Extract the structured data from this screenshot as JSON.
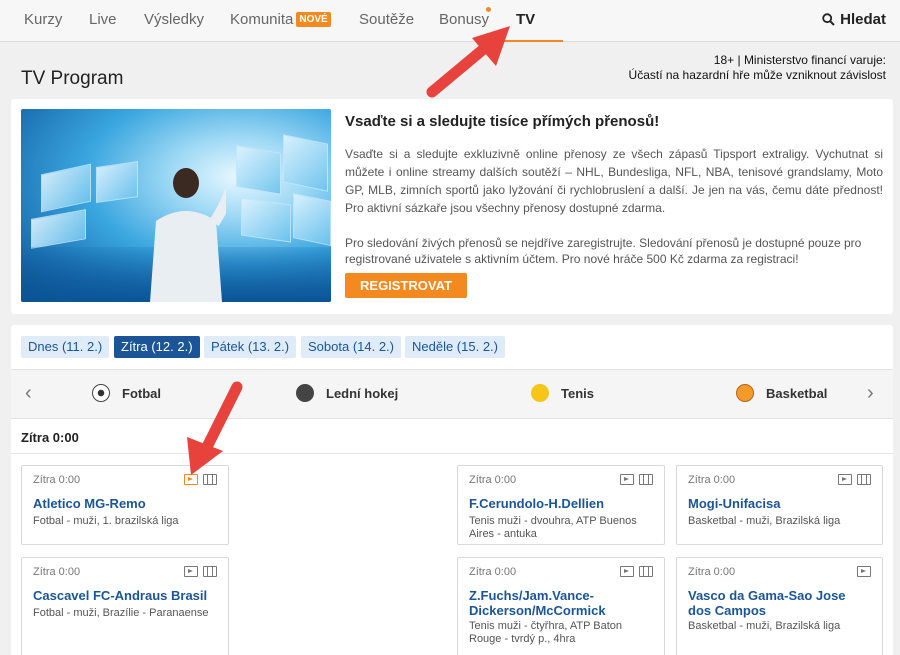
{
  "nav": {
    "items": [
      {
        "label": "Kurzy"
      },
      {
        "label": "Live"
      },
      {
        "label": "Výsledky"
      },
      {
        "label": "Komunita",
        "badge": "NOVÉ"
      },
      {
        "label": "Soutěže"
      },
      {
        "label": "Bonusy"
      },
      {
        "label": "TV",
        "active": true
      }
    ],
    "search_label": "Hledat"
  },
  "page_title": "TV Program",
  "warning": {
    "line1": "18+ | Ministerstvo financí varuje:",
    "line2": "Účastí na hazardní hře může vzniknout závislost"
  },
  "promo": {
    "title": "Vsaďte si a sledujte tisíce přímých přenosů!",
    "text": "Vsaďte si a sledujte exkluzivně online přenosy ze všech zápasů Tipsport extraligy. Vychutnat si můžete i online streamy dalších soutěží – NHL, Bundesliga, NFL, NBA, tenisové grandslamy, Moto GP, MLB, zimních sportů jako lyžování či rychlobruslení a další. Je jen na vás, čemu dáte přednost! Pro aktivní sázkaře jsou všechny přenosy dostupné zdarma.",
    "text2": "Pro sledování živých přenosů se nejdříve zaregistrujte. Sledování přenosů je dostupné pouze pro registrované uživatele s aktivním účtem. Pro nové hráče 500 Kč zdarma za registraci!",
    "button": "REGISTROVAT"
  },
  "days": [
    {
      "label": "Dnes (11. 2.)"
    },
    {
      "label": "Zítra (12. 2.)",
      "selected": true
    },
    {
      "label": "Pátek (13. 2.)"
    },
    {
      "label": "Sobota (14. 2.)"
    },
    {
      "label": "Neděle (15. 2.)"
    }
  ],
  "sports": [
    {
      "label": "Fotbal",
      "icon": "football-icon"
    },
    {
      "label": "Lední hokej",
      "icon": "hockey-puck-icon"
    },
    {
      "label": "Tenis",
      "icon": "tennis-ball-icon"
    },
    {
      "label": "Basketbal",
      "icon": "basketball-icon"
    }
  ],
  "section_title": "Zítra 0:00",
  "cards": [
    {
      "time": "Zítra 0:00",
      "match": "Atletico MG-Remo",
      "info": "Fotbal - muži, 1. brazilská liga",
      "tv_active": true,
      "stats": true
    },
    {
      "time": "Zítra 0:00",
      "match": "F.Cerundolo-H.Dellien",
      "info": "Tenis muži - dvouhra, ATP Buenos Aires - antuka",
      "stats": true
    },
    {
      "time": "Zítra 0:00",
      "match": "Mogi-Unifacisa",
      "info": "Basketbal - muži, Brazilská liga",
      "stats": true
    },
    {
      "time": "Zítra 0:00",
      "match": "Cascavel FC-Andraus Brasil",
      "info": "Fotbal - muži, Brazílie - Paranaense",
      "stats": true
    },
    {
      "time": "Zítra 0:00",
      "match": "Z.Fuchs/Jam.Vance-Dickerson/McCormick",
      "info": "Tenis muži - čtyřhra, ATP Baton Rouge - tvrdý p., 4hra",
      "stats": true
    },
    {
      "time": "Zítra 0:00",
      "match": "Vasco da Gama-Sao Jose dos Campos",
      "info": "Basketbal - muži, Brazilská liga",
      "stats": false
    }
  ],
  "colors": {
    "accent": "#f48a1f",
    "brand": "#1b5597",
    "arrow": "#e8423c"
  }
}
